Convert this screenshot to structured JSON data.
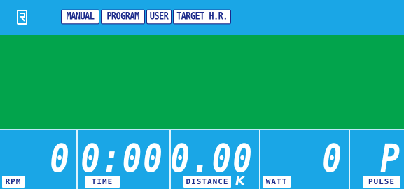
{
  "modes": {
    "manual": "MANUAL",
    "program": "PROGRAM",
    "user": "USER",
    "target_hr": "TARGET H.R."
  },
  "readouts": {
    "rpm": {
      "value": "0",
      "label": "RPM"
    },
    "time": {
      "value": "0:00",
      "label": "TIME"
    },
    "distance": {
      "value": "0.00",
      "label": "DISTANCE",
      "unit": "K"
    },
    "watt": {
      "value": "0",
      "label": "WATT"
    },
    "pulse": {
      "value": "P",
      "label": "PULSE"
    }
  },
  "colors": {
    "screen_blue": "#1aa6e6",
    "matrix_green": "#02a44c",
    "label_navy": "#1b2a8a"
  }
}
